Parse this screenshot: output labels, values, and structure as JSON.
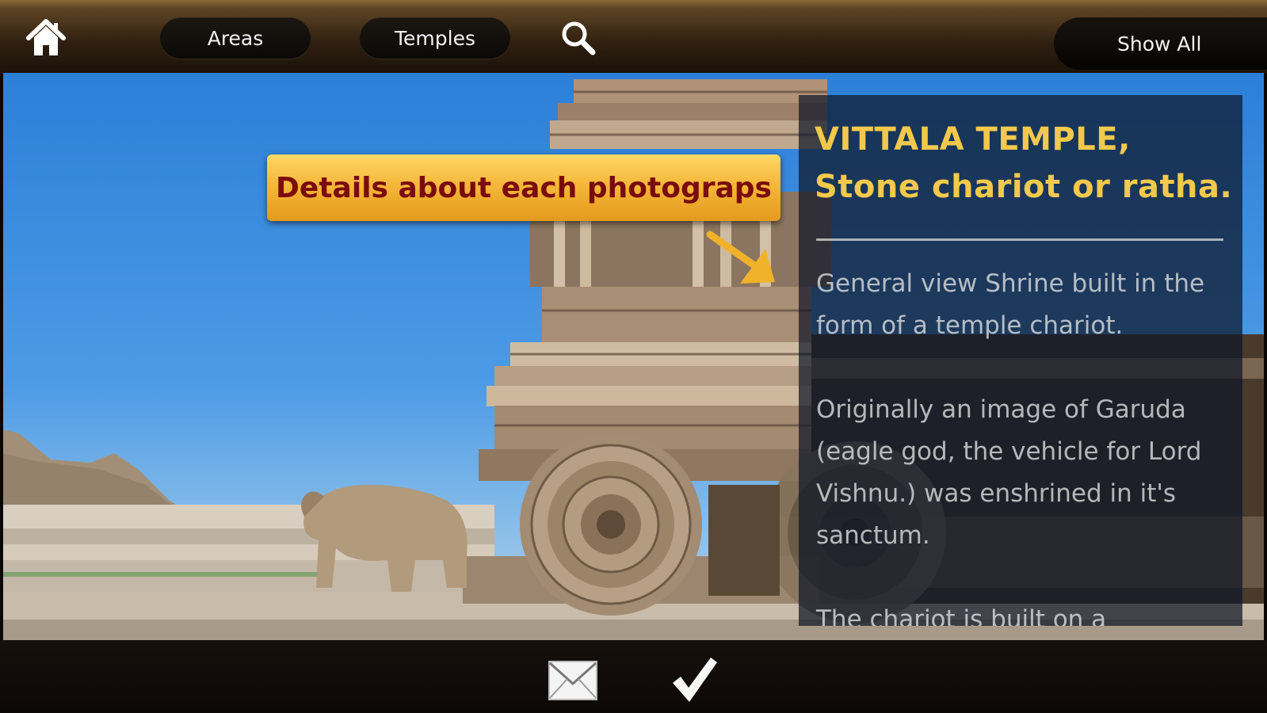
{
  "toolbar": {
    "home_icon": "home-icon",
    "areas_label": "Areas",
    "temples_label": "Temples",
    "search_icon": "search-icon",
    "show_all_label": "Show All"
  },
  "photo": {
    "subject": "stone-chariot-photo"
  },
  "info": {
    "title_line1": "VITTALA TEMPLE,",
    "title_line2": "Stone chariot or ratha.",
    "paragraph1": "General view Shrine built in the form of a temple chariot.",
    "paragraph2": "Originally an image of Garuda (eagle god, the vehicle for Lord Vishnu.) was enshrined in it's sanctum.",
    "paragraph3": "The chariot is built on a"
  },
  "callout": {
    "text": "Details about each photograps"
  },
  "bottombar": {
    "mail_icon": "mail-icon",
    "check_icon": "checkmark-icon"
  },
  "colors": {
    "accent_gold": "#f2c94c",
    "callout_bg": "#f5b73a",
    "callout_text": "#7a0c0c",
    "panel_bg": "#0e1628",
    "sky": "#2c7fd8"
  }
}
